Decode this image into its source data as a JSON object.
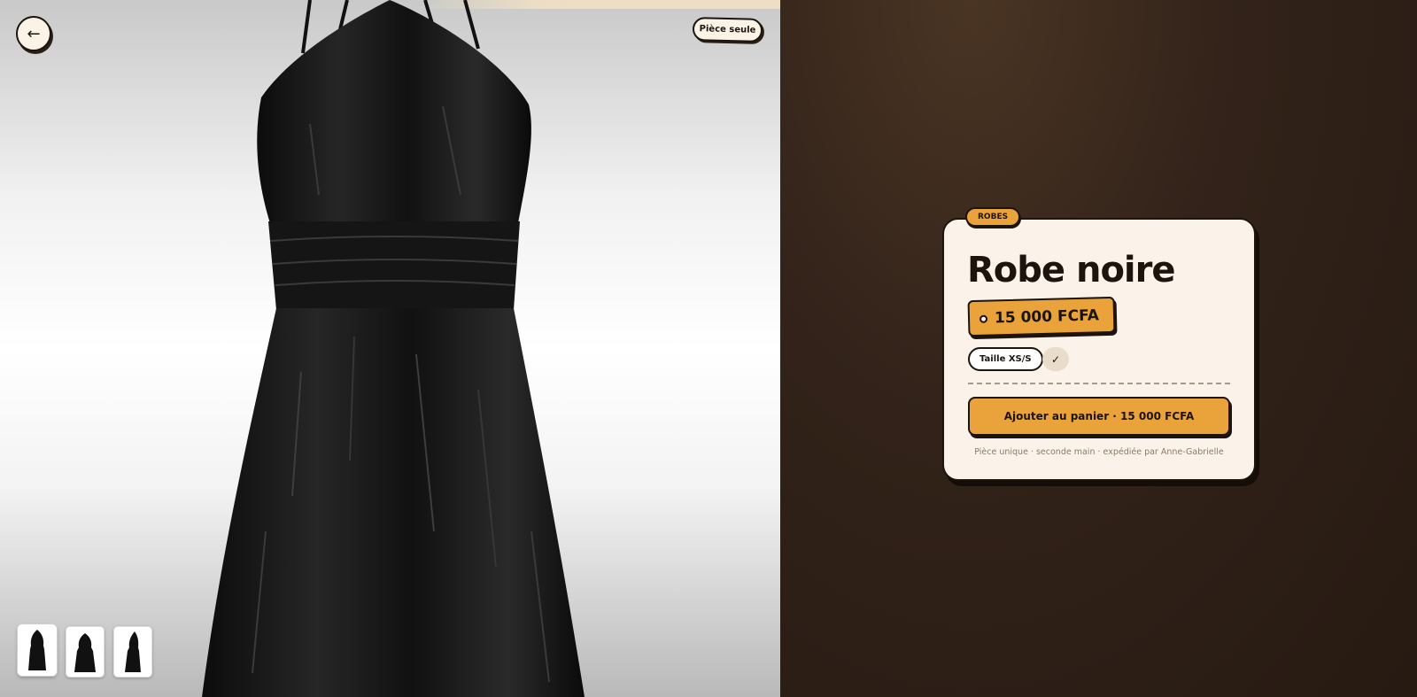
{
  "nav": {
    "back_icon": "←"
  },
  "photo": {
    "badge": "Pièce seule",
    "thumbnails": [
      {
        "name": "thumbnail-1",
        "active": true
      },
      {
        "name": "thumbnail-2",
        "active": false
      },
      {
        "name": "thumbnail-3",
        "active": false
      }
    ]
  },
  "product": {
    "category": "ROBES",
    "title": "Robe noire",
    "price": "15 000 FCFA",
    "size": "Taille XS/S",
    "size_check": "✓",
    "add_to_cart": "Ajouter au panier · 15 000 FCFA",
    "footnote": "Pièce unique · seconde main · expédiée par Anne-Gabrielle"
  },
  "colors": {
    "accent": "#eaa23a",
    "dark": "#1c140d",
    "card": "#fbf3e9",
    "background": "#2a1c12"
  }
}
